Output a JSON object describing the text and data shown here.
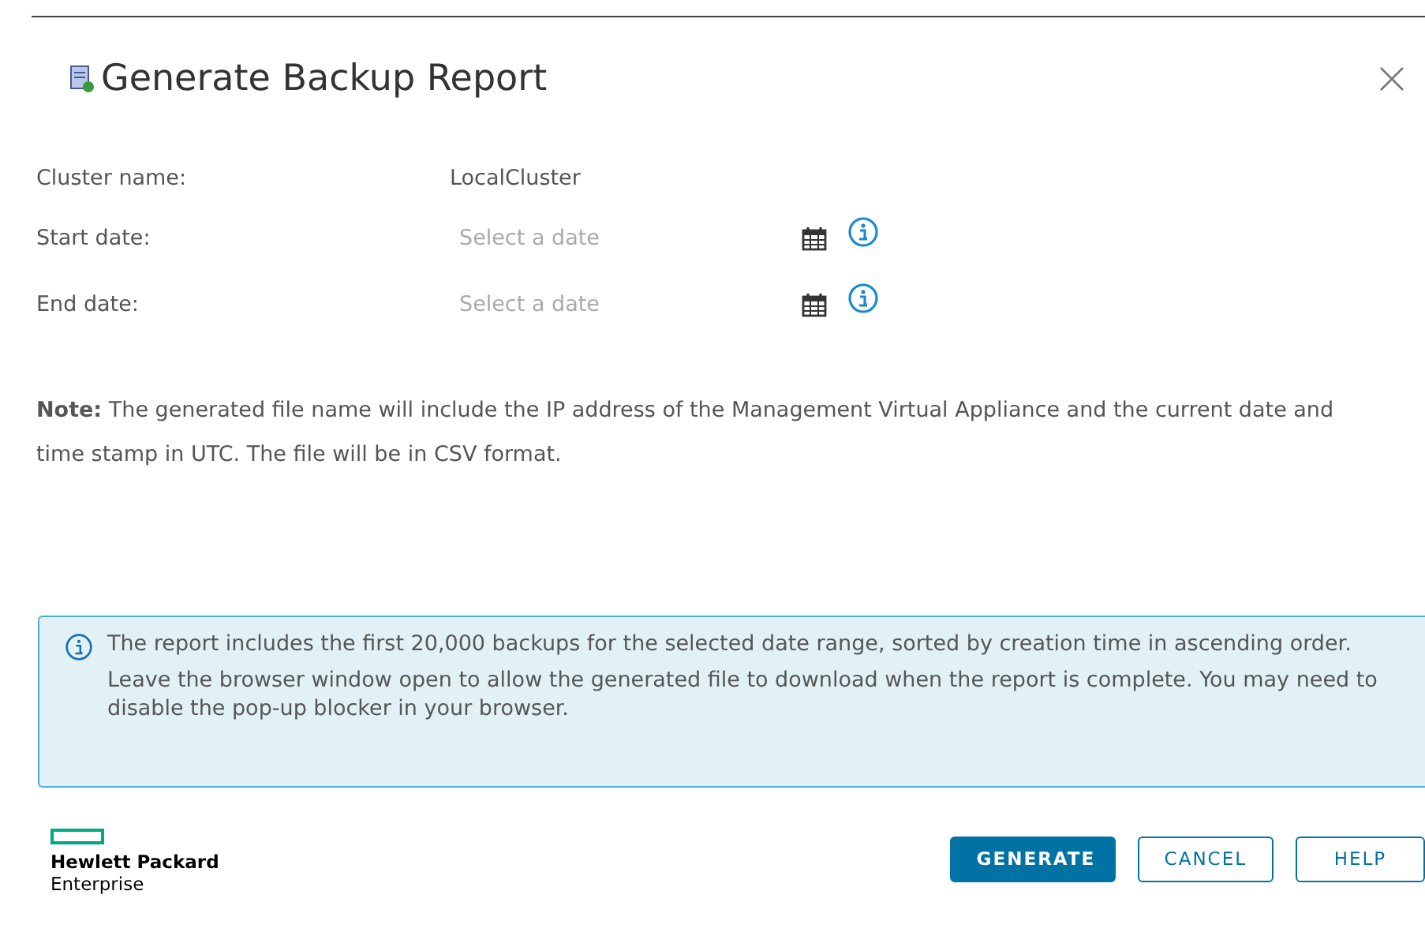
{
  "dialog": {
    "title": "Generate Backup Report"
  },
  "fields": [
    {
      "kind": "text",
      "label": "Cluster name:",
      "value": "LocalCluster"
    },
    {
      "kind": "date",
      "label": "Start date:",
      "placeholder": "Select a date"
    },
    {
      "kind": "date",
      "label": "End date:",
      "placeholder": "Select a date"
    }
  ],
  "note": "**Note:** The generated file name will include the IP address of the Management Virtual Appliance and the current date and time stamp in UTC. The file will be in CSV format.",
  "info_box": {
    "messages": [
      "The report includes the first 20,000 backups for the selected date range, sorted by creation time in ascending order.",
      "Leave the browser window open to allow the generated file to download when the report is complete. You may need to disable the pop-up blocker in your browser."
    ]
  },
  "logo": {
    "lines": [
      "Hewlett Packard",
      "Enterprise"
    ]
  },
  "buttons": [
    {
      "label": "GENERATE",
      "kind": "primary"
    },
    {
      "label": "CANCEL",
      "kind": "outline"
    },
    {
      "label": "HELP",
      "kind": "outline"
    }
  ]
}
